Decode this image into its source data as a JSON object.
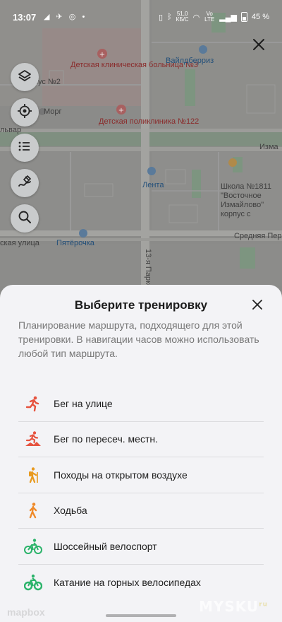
{
  "status_bar": {
    "time": "13:07",
    "left_icons": "◢ ✈ ◎ •",
    "speed_value": "51,0",
    "speed_unit": "КБ/С",
    "network": "Vo LTE",
    "battery": "45 %"
  },
  "top_close_icon": "close-icon",
  "map_labels": {
    "children_hospital": "Детская клиническая больница №3",
    "corpus2": "пус №2",
    "wildberries": "Вайлдберриз",
    "morg": "Морг",
    "polyclinic": "Детская поликлиника №122",
    "bulvar": "львар",
    "izma": "Изма",
    "lenta": "Лента",
    "school": "Школа №1811 \"Восточное Измайлово\" корпус с",
    "pyaterochka": "Пятёрочка",
    "ksk_street": "ская улица",
    "srednyaya": "Средняя Пер",
    "park_street": "13-я Парко"
  },
  "map_controls": [
    {
      "name": "layers-button",
      "icon": "layers-icon"
    },
    {
      "name": "my-location-button",
      "icon": "crosshair-icon"
    },
    {
      "name": "list-button",
      "icon": "list-icon"
    },
    {
      "name": "draw-route-button",
      "icon": "route-draw-icon"
    },
    {
      "name": "search-button",
      "icon": "search-icon"
    }
  ],
  "sheet": {
    "title": "Выберите тренировку",
    "close_icon": "close-icon",
    "description": "Планирование маршрута, подходящего для этой тренировки. В навигации часов можно использовать любой тип маршрута.",
    "workouts": [
      {
        "label": "Бег на улице",
        "icon": "running-icon",
        "color": "#e6533f"
      },
      {
        "label": "Бег по пересеч. местн.",
        "icon": "trail-running-icon",
        "color": "#e6533f"
      },
      {
        "label": "Походы на открытом воздухе",
        "icon": "hiking-icon",
        "color": "#e89a1f"
      },
      {
        "label": "Ходьба",
        "icon": "walking-icon",
        "color": "#ef8a2a"
      },
      {
        "label": "Шоссейный велоспорт",
        "icon": "road-cycling-icon",
        "color": "#2bb36a"
      },
      {
        "label": "Катание на горных велосипедах",
        "icon": "mountain-biking-icon",
        "color": "#2bb36a"
      }
    ]
  },
  "map_attribution": "mapbox",
  "watermark": "MYSKU",
  "watermark_sup": "ru"
}
